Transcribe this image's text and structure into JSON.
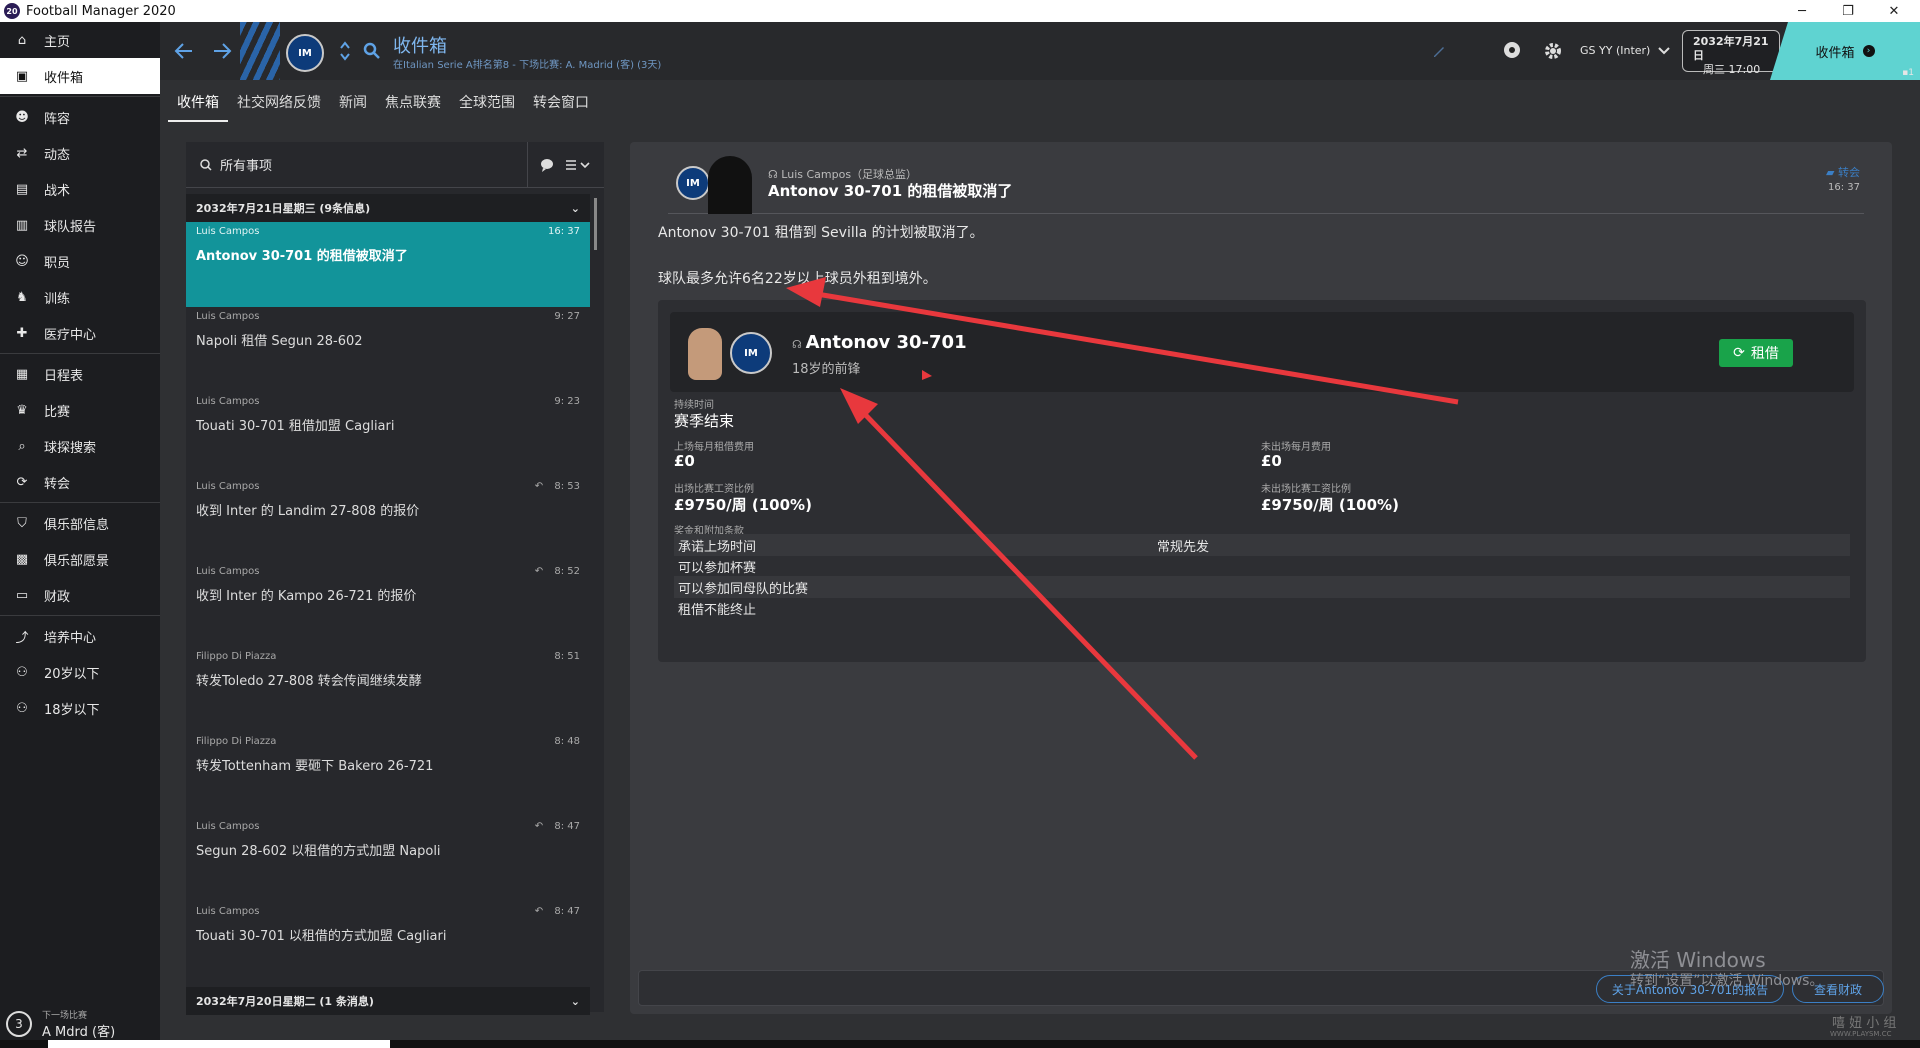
{
  "window": {
    "title": "Football Manager 2020",
    "app_badge": "20",
    "minimize": "─",
    "maximize": "❐",
    "close": "✕"
  },
  "sidebar": {
    "items": [
      {
        "label": "主页",
        "icon": "home-icon"
      },
      {
        "label": "收件箱",
        "icon": "inbox-icon",
        "active": true
      },
      {
        "label": "阵容",
        "icon": "squad-icon"
      },
      {
        "label": "动态",
        "icon": "dynamics-icon"
      },
      {
        "label": "战术",
        "icon": "tactics-icon"
      },
      {
        "label": "球队报告",
        "icon": "report-icon"
      },
      {
        "label": "职员",
        "icon": "staff-icon"
      },
      {
        "label": "训练",
        "icon": "training-icon"
      },
      {
        "label": "医疗中心",
        "icon": "medical-icon"
      },
      {
        "label": "日程表",
        "icon": "calendar-icon"
      },
      {
        "label": "比赛",
        "icon": "trophy-icon"
      },
      {
        "label": "球探搜索",
        "icon": "scouting-icon"
      },
      {
        "label": "转会",
        "icon": "transfers-icon"
      },
      {
        "label": "俱乐部信息",
        "icon": "shield-icon"
      },
      {
        "label": "俱乐部愿景",
        "icon": "vision-icon"
      },
      {
        "label": "财政",
        "icon": "finance-icon"
      },
      {
        "label": "培养中心",
        "icon": "development-icon"
      },
      {
        "label": "20岁以下",
        "icon": "u20-icon"
      },
      {
        "label": "18岁以下",
        "icon": "u18-icon"
      }
    ],
    "next_match": {
      "label": "下一场比赛",
      "opponent": "A Mdrd (客)",
      "days": "3"
    }
  },
  "topbar": {
    "title": "收件箱",
    "subtitle": "在Italian Serie A排名第8 - 下场比赛: A. Madrid (客) (3天)",
    "manager": "GS YY (Inter)",
    "date_line1": "2032年7月21日",
    "date_line2": "周三 17:00",
    "inbox_button": "收件箱",
    "club_crest": "IM",
    "corner_badge": "1"
  },
  "tabs": [
    "收件箱",
    "社交网络反馈",
    "新闻",
    "焦点联赛",
    "全球范围",
    "转会窗口"
  ],
  "inbox": {
    "search_placeholder": "所有事项",
    "days": [
      {
        "header": "2032年7月21日星期三 (9条信息)",
        "messages": [
          {
            "from": "Luis Campos",
            "time": "16: 37",
            "subject": "Antonov 30-701 的租借被取消了",
            "selected": true,
            "reply": false
          },
          {
            "from": "Luis Campos",
            "time": "9: 27",
            "subject": "Napoli 租借 Segun 28-602",
            "reply": false
          },
          {
            "from": "Luis Campos",
            "time": "9: 23",
            "subject": "Touati 30-701 租借加盟 Cagliari",
            "reply": false
          },
          {
            "from": "Luis Campos",
            "time": "8: 53",
            "subject": "收到 Inter 的 Landim 27-808 的报价",
            "reply": true
          },
          {
            "from": "Luis Campos",
            "time": "8: 52",
            "subject": "收到 Inter 的 Kampo 26-721 的报价",
            "reply": true
          },
          {
            "from": "Filippo Di Piazza",
            "time": "8: 51",
            "subject": "转发Toledo 27-808 转会传闻继续发酵",
            "reply": false
          },
          {
            "from": "Filippo Di Piazza",
            "time": "8: 48",
            "subject": "转发Tottenham 要砸下 Bakero 26-721",
            "reply": false
          },
          {
            "from": "Luis Campos",
            "time": "8: 47",
            "subject": "Segun 28-602 以租借的方式加盟 Napoli",
            "reply": true
          },
          {
            "from": "Luis Campos",
            "time": "8: 47",
            "subject": "Touati 30-701 以租借的方式加盟 Cagliari",
            "reply": true
          }
        ]
      },
      {
        "header": "2032年7月20日星期二 (1 条消息)",
        "messages": []
      }
    ]
  },
  "detail": {
    "sender": "Luis Campos（足球总监）",
    "title": "Antonov 30-701 的租借被取消了",
    "category": "转会",
    "time": "16: 37",
    "body1": "Antonov 30-701 租借到 Sevilla 的计划被取消了。",
    "body2": "球队最多允许6名22岁以上球员外租到境外。",
    "player_name": "Antonov 30-701",
    "player_desc": "18岁的前锋",
    "loan_button": "租借",
    "duration_label": "持续时间",
    "duration_value": "赛季结束",
    "monthly_fee_label": "上场每月租借费用",
    "monthly_fee_value": "£0",
    "unused_fee_label": "未出场每月费用",
    "unused_fee_value": "£0",
    "wage_label": "出场比赛工资比例",
    "wage_value": "£9750/周 (100%)",
    "unused_wage_label": "未出场比赛工资比例",
    "unused_wage_value": "£9750/周 (100%)",
    "bonus_label": "奖金和附加条款",
    "clauses": [
      {
        "left": "承诺上场时间",
        "right": "常规先发"
      },
      {
        "left": "可以参加杯赛",
        "right": ""
      },
      {
        "left": "可以参加同母队的比赛",
        "right": ""
      },
      {
        "left": "租借不能终止",
        "right": ""
      }
    ],
    "report_button": "关于Antonov 30-701的报告",
    "finance_button": "查看财政"
  },
  "watermark": {
    "line1": "激活 Windows",
    "line2": "转到“设置”以激活 Windows。",
    "site_logo": "嘻 妞 小 组",
    "site_url": "WWW.PLAYSM.CC"
  },
  "colors": {
    "accent": "#12949a",
    "loan_green": "#19a34a",
    "annotation_red": "#e8383d",
    "title_blue": "#7fb6ee"
  }
}
